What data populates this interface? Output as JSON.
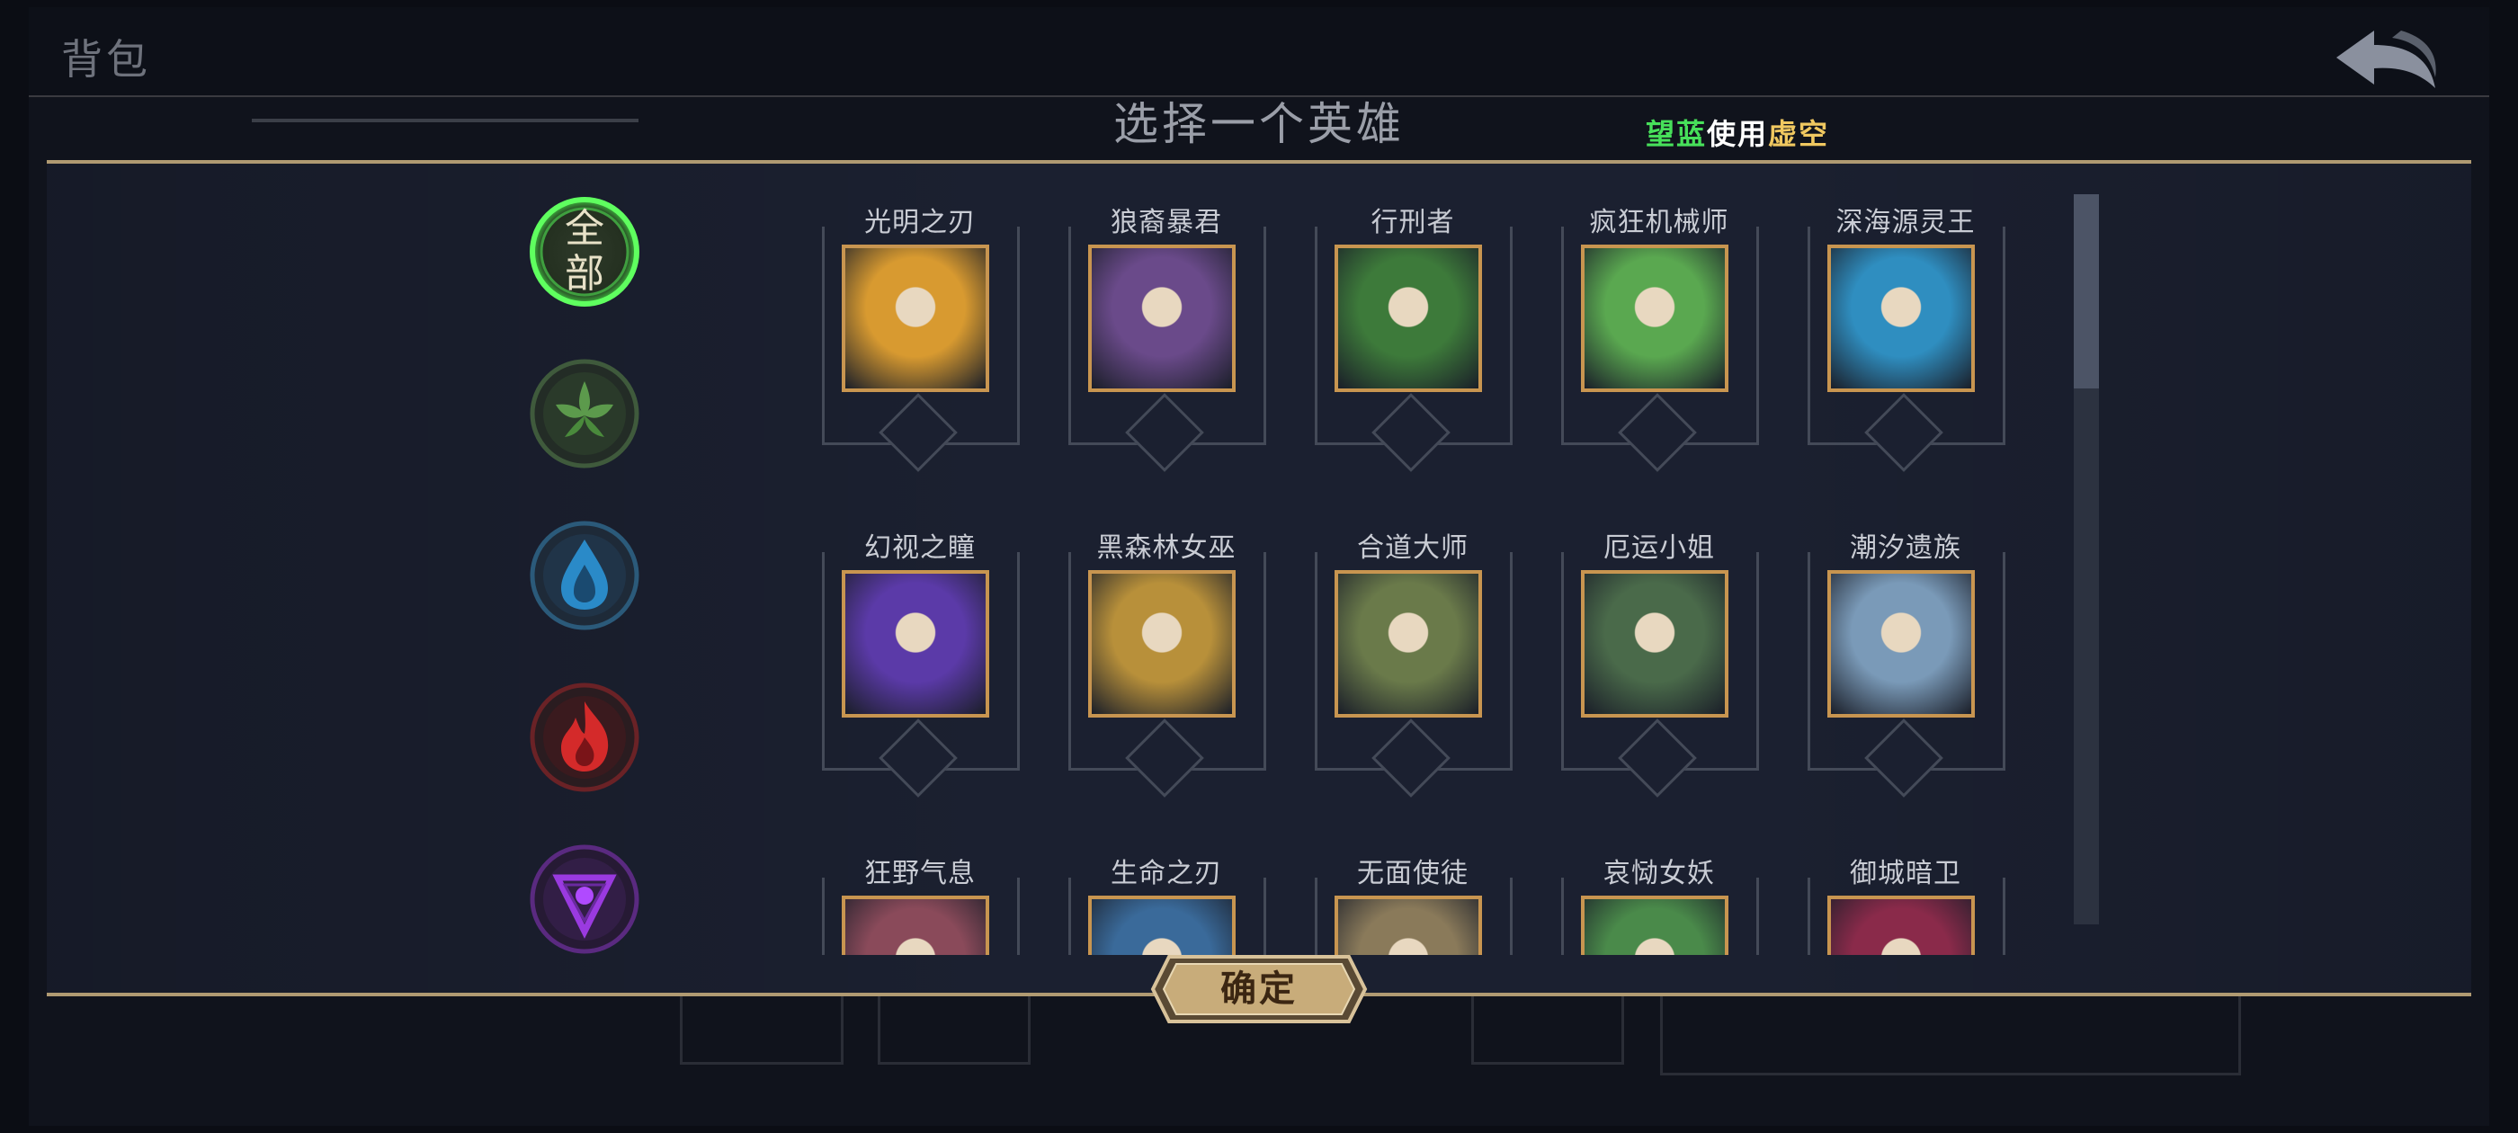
{
  "header": {
    "title": "背包",
    "back_icon": "back-arrow-icon"
  },
  "dialog": {
    "title": "选择一个英雄",
    "notice": {
      "part1": "望蓝",
      "part2": "使用",
      "part3": "虚空"
    },
    "confirm_label": "确定"
  },
  "factions": [
    {
      "id": "all",
      "label": "全部",
      "icon": "all-faction-icon",
      "selected": true,
      "color": "#3fbf3f"
    },
    {
      "id": "nature",
      "icon": "leaf-faction-icon",
      "color": "#3f7a3a"
    },
    {
      "id": "water",
      "icon": "water-faction-icon",
      "color": "#2b79a8"
    },
    {
      "id": "fire",
      "icon": "fire-faction-icon",
      "color": "#c0262a"
    },
    {
      "id": "void",
      "icon": "void-faction-icon",
      "color": "#8a2bd0"
    }
  ],
  "heroes": [
    {
      "name": "光明之刃",
      "portrait_color": "#d89a30"
    },
    {
      "name": "狼裔暴君",
      "portrait_color": "#6a4a8a"
    },
    {
      "name": "行刑者",
      "portrait_color": "#3d7a3a"
    },
    {
      "name": "疯狂机械师",
      "portrait_color": "#5aa850"
    },
    {
      "name": "深海源灵王",
      "portrait_color": "#2f8ec0"
    },
    {
      "name": "幻视之瞳",
      "portrait_color": "#5b3aa8"
    },
    {
      "name": "黑森林女巫",
      "portrait_color": "#b8903a"
    },
    {
      "name": "合道大师",
      "portrait_color": "#6a7a4a"
    },
    {
      "name": "厄运小姐",
      "portrait_color": "#4a6a4a"
    },
    {
      "name": "潮汐遗族",
      "portrait_color": "#7a9ab8"
    },
    {
      "name": "狂野气息",
      "portrait_color": "#8a4a5a"
    },
    {
      "name": "生命之刃",
      "portrait_color": "#3a6a9a"
    },
    {
      "name": "无面使徒",
      "portrait_color": "#8a7a5a"
    },
    {
      "name": "哀恸女妖",
      "portrait_color": "#4a8a4a"
    },
    {
      "name": "御城暗卫",
      "portrait_color": "#8a2a4a"
    }
  ],
  "colors": {
    "accent_gold": "#b09a72",
    "panel": "#1b2030",
    "portrait_border": "#c89550"
  }
}
